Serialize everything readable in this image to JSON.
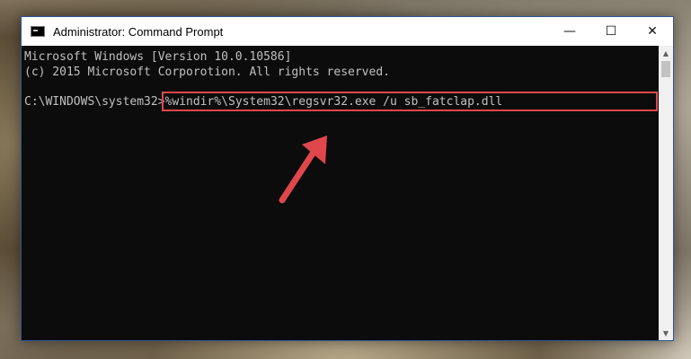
{
  "window": {
    "title": "Administrator: Command Prompt",
    "controls": {
      "minimize": "—",
      "maximize": "☐",
      "close": "✕"
    }
  },
  "console": {
    "line1": "Microsoft Windows [Version 10.0.10586]",
    "line2": "(c) 2015 Microsoft Corporotion. All rights reserved.",
    "prompt": "C:\\WINDOWS\\system32>",
    "command": "%windir%\\System32\\regsvr32.exe /u sb_fatclap.dll"
  },
  "scrollbar": {
    "up": "▲",
    "down": "▼"
  },
  "colors": {
    "highlight": "#e0474c",
    "arrow": "#e0474c",
    "console_bg": "#0c0c0c"
  }
}
